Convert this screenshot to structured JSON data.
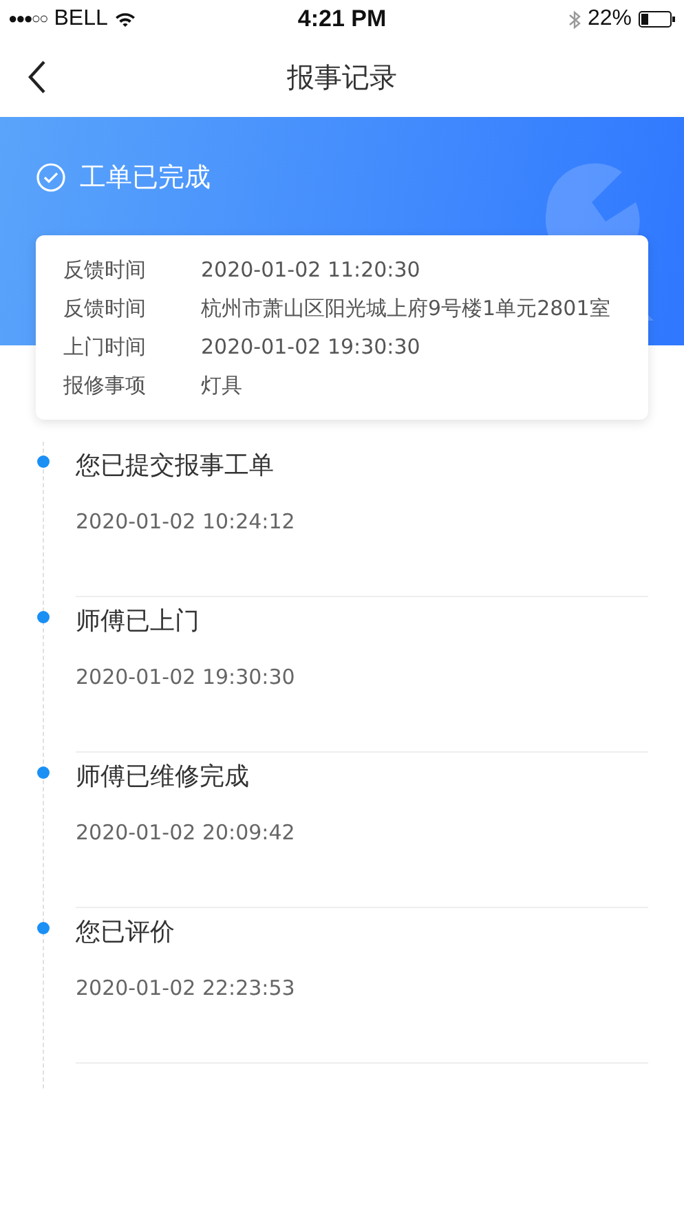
{
  "status_bar": {
    "signal": "●●●○○",
    "carrier": "BELL",
    "time": "4:21 PM",
    "battery": "22%"
  },
  "nav": {
    "title": "报事记录"
  },
  "banner": {
    "status": "工单已完成"
  },
  "details": [
    {
      "label": "反馈时间",
      "value": "2020-01-02 11:20:30"
    },
    {
      "label": "反馈时间",
      "value": "杭州市萧山区阳光城上府9号楼1单元2801室"
    },
    {
      "label": "上门时间",
      "value": "2020-01-02 19:30:30"
    },
    {
      "label": "报修事项",
      "value": "灯具"
    }
  ],
  "timeline": [
    {
      "title": "您已提交报事工单",
      "time": "2020-01-02 10:24:12"
    },
    {
      "title": "师傅已上门",
      "time": "2020-01-02 19:30:30"
    },
    {
      "title": "师傅已维修完成",
      "time": "2020-01-02 20:09:42"
    },
    {
      "title": "您已评价",
      "time": "2020-01-02 22:23:53"
    }
  ]
}
